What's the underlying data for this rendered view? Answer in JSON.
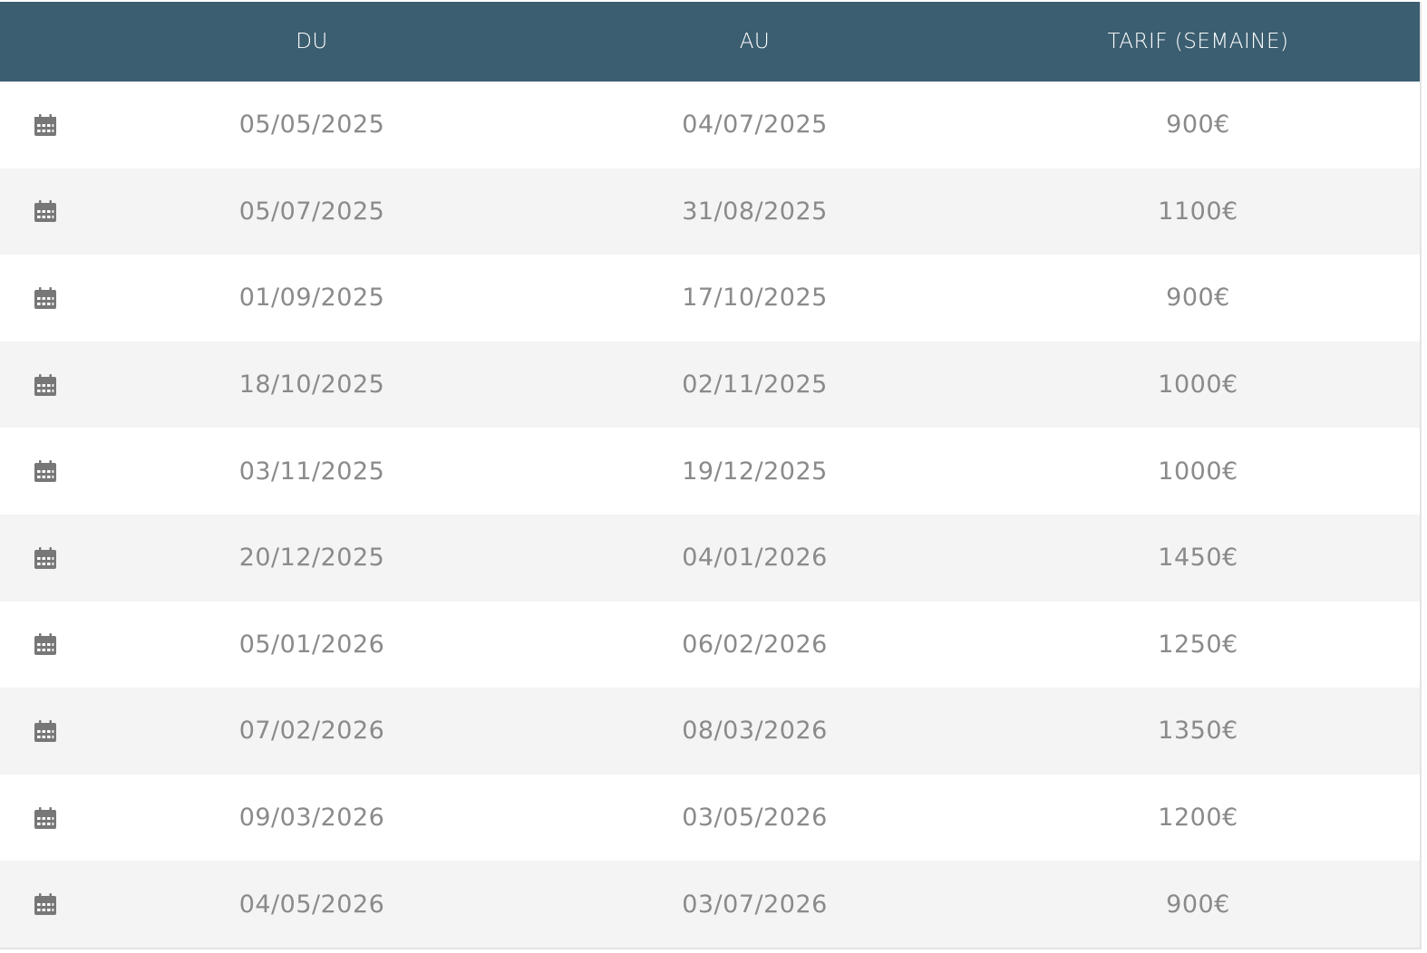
{
  "table": {
    "headers": {
      "du": "DU",
      "au": "AU",
      "tarif": "TARIF (SEMAINE)"
    },
    "rows": [
      {
        "du": "05/05/2025",
        "au": "04/07/2025",
        "tarif": "900€"
      },
      {
        "du": "05/07/2025",
        "au": "31/08/2025",
        "tarif": "1100€"
      },
      {
        "du": "01/09/2025",
        "au": "17/10/2025",
        "tarif": "900€"
      },
      {
        "du": "18/10/2025",
        "au": "02/11/2025",
        "tarif": "1000€"
      },
      {
        "du": "03/11/2025",
        "au": "19/12/2025",
        "tarif": "1000€"
      },
      {
        "du": "20/12/2025",
        "au": "04/01/2026",
        "tarif": "1450€"
      },
      {
        "du": "05/01/2026",
        "au": "06/02/2026",
        "tarif": "1250€"
      },
      {
        "du": "07/02/2026",
        "au": "08/03/2026",
        "tarif": "1350€"
      },
      {
        "du": "09/03/2026",
        "au": "03/05/2026",
        "tarif": "1200€"
      },
      {
        "du": "04/05/2026",
        "au": "03/07/2026",
        "tarif": "900€"
      }
    ],
    "row_icon": "calendar-icon",
    "colors": {
      "header_bg": "#3b5e70",
      "header_text": "#ffffff",
      "row_alt_bg": "#f4f4f4",
      "cell_text": "#8a8a8a",
      "icon": "#777777"
    }
  }
}
